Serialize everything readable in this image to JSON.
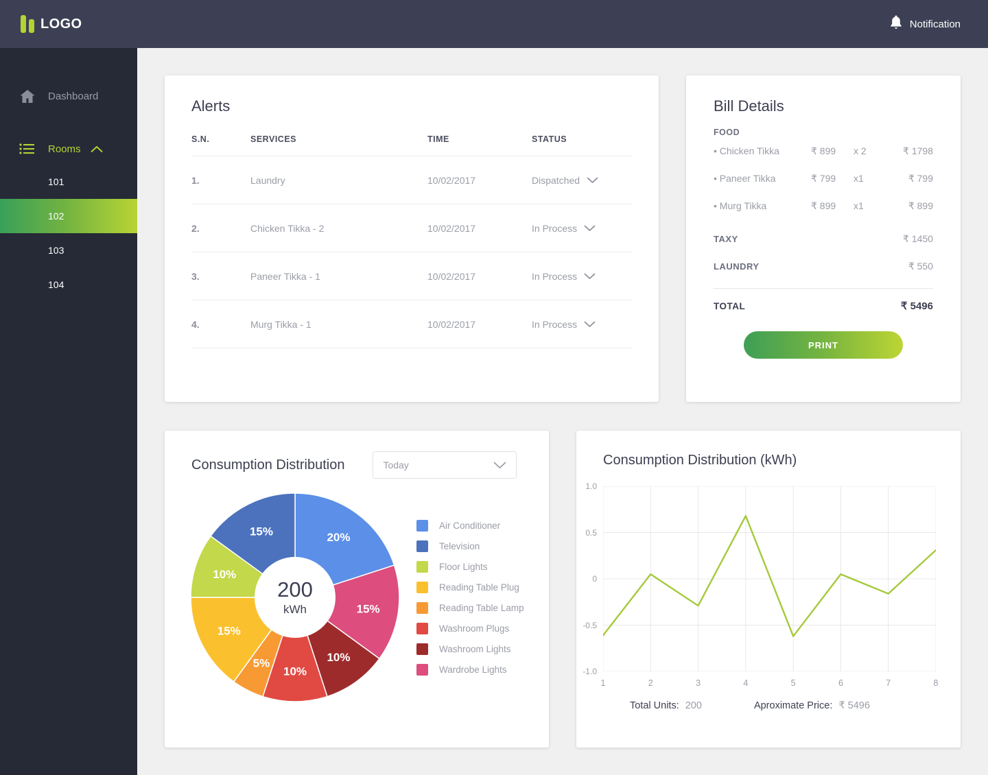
{
  "brand": {
    "logo_text": "LOGO",
    "logo_color": "#b5d233"
  },
  "topbar": {
    "notification_label": "Notification",
    "notification_icon": "bell-icon",
    "background": "#3d4054"
  },
  "sidebar": {
    "background": "#262a36",
    "dashboard": {
      "label": "Dashboard",
      "icon": "home-icon"
    },
    "rooms": {
      "label": "Rooms",
      "icon": "list-icon",
      "chevron": "chevron-up-icon",
      "expanded": true
    },
    "rooms_list": [
      {
        "label": "101",
        "active": false
      },
      {
        "label": "102",
        "active": true
      },
      {
        "label": "103",
        "active": false
      },
      {
        "label": "104",
        "active": false
      }
    ],
    "active_gradient": [
      "#38a05a",
      "#b9d334"
    ]
  },
  "alerts": {
    "title": "Alerts",
    "columns": [
      "S.N.",
      "SERVICES",
      "TIME",
      "STATUS"
    ],
    "rows": [
      {
        "sn": "1.",
        "service": "Laundry",
        "time": "10/02/2017",
        "status": "Dispatched"
      },
      {
        "sn": "2.",
        "service": "Chicken Tikka - 2",
        "time": "10/02/2017",
        "status": "In Process"
      },
      {
        "sn": "3.",
        "service": "Paneer Tikka - 1",
        "time": "10/02/2017",
        "status": "In Process"
      },
      {
        "sn": "4.",
        "service": "Murg Tikka - 1",
        "time": "10/02/2017",
        "status": "In Process"
      }
    ]
  },
  "bill": {
    "title": "Bill Details",
    "food_label": "FOOD",
    "food_items": [
      {
        "name": "• Chicken Tikka",
        "price": "₹ 899",
        "qty": "x 2",
        "total": "₹ 1798"
      },
      {
        "name": "• Paneer Tikka",
        "price": "₹ 799",
        "qty": "x1",
        "total": "₹ 799"
      },
      {
        "name": "• Murg Tikka",
        "price": "₹ 899",
        "qty": "x1",
        "total": "₹ 899"
      }
    ],
    "lines": [
      {
        "label": "TAXY",
        "value": "₹ 1450"
      },
      {
        "label": "LAUNDRY",
        "value": "₹ 550"
      }
    ],
    "total_label": "TOTAL",
    "total_value": "₹ 5496",
    "print_label": "PRINT"
  },
  "donut": {
    "title": "Consumption Distribution",
    "period_selected": "Today",
    "chevron": "chevron-down-icon",
    "center_value": "200",
    "center_unit": "kWh"
  },
  "line": {
    "title": "Consumption Distribution (kWh)",
    "total_units_label": "Total Units:",
    "total_units_value": "200",
    "approx_price_label": "Aproximate Price:",
    "approx_price_value": "₹ 5496"
  },
  "chart_data": [
    {
      "type": "pie",
      "title": "Consumption Distribution",
      "center_label": "200 kWh",
      "legend_position": "right",
      "categories": [
        "Air Conditioner",
        "Television",
        "Floor Lights",
        "Reading Table Plug",
        "Reading Table Lamp",
        "Washroom Plugs",
        "Washroom Lights",
        "Wardrobe Lights"
      ],
      "values": [
        20,
        15,
        10,
        15,
        5,
        10,
        10,
        15
      ],
      "labels": [
        "20%",
        "15%",
        "10%",
        "15%",
        "5%",
        "10%",
        "10%",
        "15%"
      ],
      "colors": [
        "#5b8fe8",
        "#4c72bd",
        "#c3d84a",
        "#fbc02d",
        "#f79a33",
        "#e04a43",
        "#9e2b2b",
        "#dd4d7e"
      ],
      "slice_order_clockwise_from_top": [
        "Air Conditioner",
        "Wardrobe Lights",
        "Washroom Lights",
        "Washroom Plugs",
        "Reading Table Lamp",
        "Reading Table Plug",
        "Floor Lights",
        "Television"
      ]
    },
    {
      "type": "line",
      "title": "Consumption Distribution (kWh)",
      "xlabel": "",
      "ylabel": "",
      "x": [
        1,
        2,
        3,
        4,
        5,
        6,
        7,
        8
      ],
      "values": [
        -0.61,
        0.05,
        -0.29,
        0.68,
        -0.62,
        0.05,
        -0.16,
        0.31
      ],
      "xticks": [
        "1",
        "2",
        "3",
        "4",
        "5",
        "6",
        "7",
        "8"
      ],
      "yticks": [
        "1.0",
        "0.5",
        "0",
        "-0.5",
        "-1.0"
      ],
      "ylim": [
        -1.0,
        1.0
      ],
      "xlim": [
        1,
        8
      ],
      "grid": true,
      "line_color": "#a5c93c",
      "legend": false
    }
  ]
}
